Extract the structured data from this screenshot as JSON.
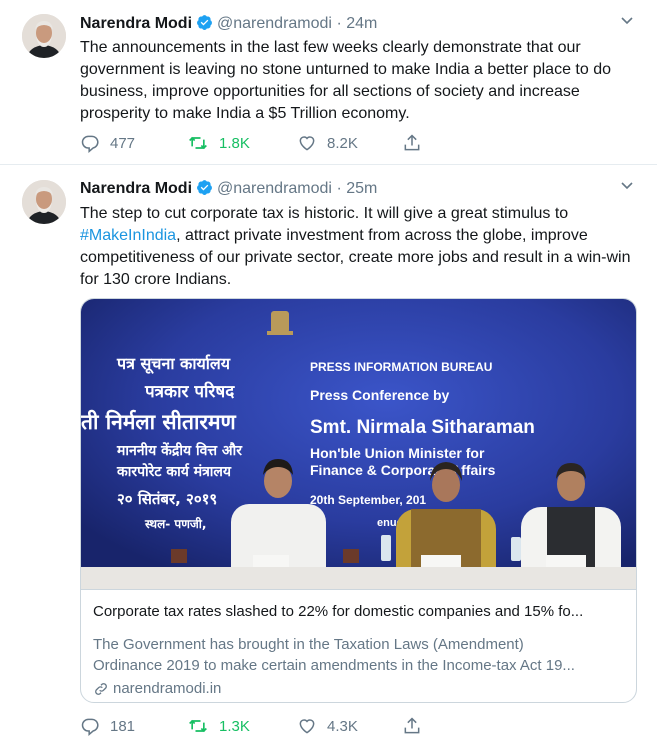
{
  "author": {
    "name": "Narendra Modi",
    "handle": "@narendramodi",
    "verified": true
  },
  "colors": {
    "text": "#14171a",
    "secondary": "#657786",
    "link": "#1b95e0",
    "retweet_active": "#17bf63",
    "verified": "#1da1f2",
    "border": "#ccd6dd"
  },
  "tweets": [
    {
      "time": "24m",
      "text": "The announcements in the last few weeks clearly demonstrate that our government is leaving no stone unturned to make India a better place to do business, improve opportunities for all sections of society and increase prosperity to make India a $5 Trillion economy.",
      "replies": "477",
      "retweets": "1.8K",
      "likes": "8.2K"
    },
    {
      "time": "25m",
      "text_before": "The step to cut corporate tax is historic. It will give a great stimulus to ",
      "hashtag": "#MakeInIndia",
      "text_after": ", attract private investment from across the globe, improve competitiveness of our private sector, create more jobs and result in a win-win for 130 crore Indians.",
      "replies": "181",
      "retweets": "1.3K",
      "likes": "4.3K",
      "card": {
        "title": "Corporate tax rates slashed to 22% for domestic companies and 15% fo...",
        "description_line1": "The Government has brought in the Taxation Laws (Amendment)",
        "description_line2": "Ordinance 2019 to make certain amendments in the Income-tax Act 19...",
        "domain": "narendramodi.in",
        "image": {
          "hindi_line1": "पत्र सूचना कार्यालय",
          "hindi_line2": "पत्रकार परिषद",
          "hindi_line3": "ती निर्मला सीतारमण",
          "hindi_line4": "माननीय केंद्रीय वित्त और",
          "hindi_line5": "कारपोरेट कार्य मंत्रालय",
          "hindi_line6": "२० सितंबर, २०१९",
          "hindi_line7": "स्थल- पणजी,",
          "en_line1": "PRESS INFORMATION BUREAU",
          "en_line2": "Press Conference by",
          "en_line3": "Smt. Nirmala Sitharaman",
          "en_line4": "Hon'ble Union Minister for",
          "en_line5": "Finance & Corporate Affairs",
          "en_line6": "20th September, 201",
          "en_line7": "enue: Panji"
        }
      }
    }
  ]
}
